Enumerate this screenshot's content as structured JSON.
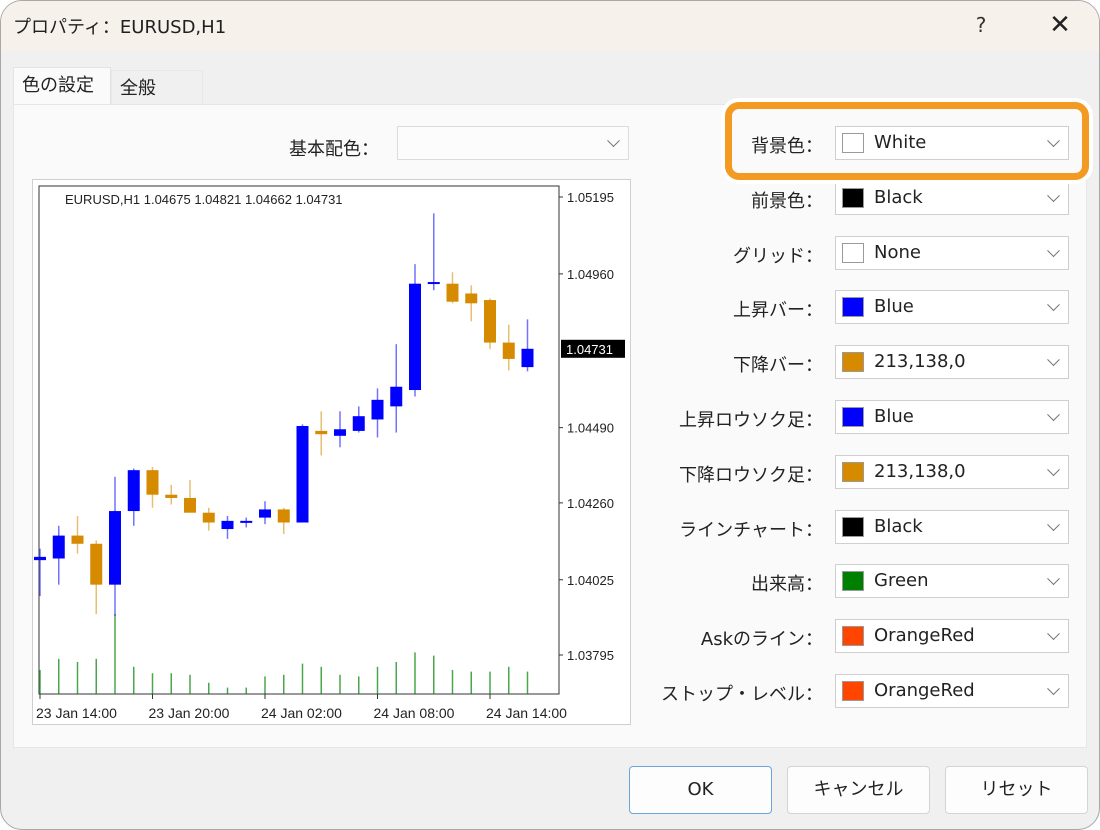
{
  "window": {
    "title": "プロパティ：EURUSD,H1",
    "help_label": "?",
    "close_label": "✕"
  },
  "tabs": [
    {
      "label": "色の設定",
      "active": true
    },
    {
      "label": "全般",
      "active": false
    }
  ],
  "base_scheme": {
    "label": "基本配色：",
    "value": ""
  },
  "color_settings": [
    {
      "label": "背景色：",
      "value": "White",
      "color": "#ffffff",
      "highlighted": true
    },
    {
      "label": "前景色：",
      "value": "Black",
      "color": "#000000"
    },
    {
      "label": "グリッド：",
      "value": "None",
      "color": "#ffffff"
    },
    {
      "label": "上昇バー：",
      "value": "Blue",
      "color": "#0000ff"
    },
    {
      "label": "下降バー：",
      "value": "213,138,0",
      "color": "#d58a00"
    },
    {
      "label": "上昇ロウソク足：",
      "value": "Blue",
      "color": "#0000ff"
    },
    {
      "label": "下降ロウソク足：",
      "value": "213,138,0",
      "color": "#d58a00"
    },
    {
      "label": "ラインチャート：",
      "value": "Black",
      "color": "#000000"
    },
    {
      "label": "出来高：",
      "value": "Green",
      "color": "#008000"
    },
    {
      "label": "Askのライン：",
      "value": "OrangeRed",
      "color": "#ff4500"
    },
    {
      "label": "ストップ・レベル：",
      "value": "OrangeRed",
      "color": "#ff4500"
    }
  ],
  "buttons": {
    "ok": "OK",
    "cancel": "キャンセル",
    "reset": "リセット"
  },
  "accent": {
    "highlight_color": "#f39a23"
  },
  "chart_data": {
    "type": "candlestick",
    "title": "EURUSD,H1  1.04675 1.04821 1.04662 1.04731",
    "symbol": "EURUSD,H1",
    "ohlc_header": [
      "1.04675",
      "1.04821",
      "1.04662",
      "1.04731"
    ],
    "current_price": "1.04731",
    "y_ticks": [
      "1.05195",
      "1.04960",
      "1.04731",
      "1.04490",
      "1.04260",
      "1.04025",
      "1.03795"
    ],
    "y_tick_values": [
      1.05195,
      1.0496,
      1.0449,
      1.0426,
      1.04025,
      1.03795
    ],
    "ylim": [
      1.0361,
      1.0524
    ],
    "x_ticks": [
      "23 Jan 14:00",
      "23 Jan 20:00",
      "24 Jan 02:00",
      "24 Jan 08:00",
      "24 Jan 14:00"
    ],
    "x_tick_index": [
      0,
      6,
      12,
      18,
      24
    ],
    "up_color": "#0000ff",
    "down_color": "#d58a00",
    "volume_color": "#008000",
    "candles": [
      {
        "o": 1.04085,
        "h": 1.0412,
        "l": 1.03975,
        "c": 1.04095
      },
      {
        "o": 1.0409,
        "h": 1.0419,
        "l": 1.0401,
        "c": 1.0416
      },
      {
        "o": 1.0416,
        "h": 1.0422,
        "l": 1.04105,
        "c": 1.04135
      },
      {
        "o": 1.04135,
        "h": 1.04145,
        "l": 1.0392,
        "c": 1.0401
      },
      {
        "o": 1.0401,
        "h": 1.0434,
        "l": 1.03915,
        "c": 1.04235
      },
      {
        "o": 1.04235,
        "h": 1.04365,
        "l": 1.0419,
        "c": 1.0436
      },
      {
        "o": 1.0436,
        "h": 1.0437,
        "l": 1.04245,
        "c": 1.04285
      },
      {
        "o": 1.04285,
        "h": 1.04315,
        "l": 1.04255,
        "c": 1.04275
      },
      {
        "o": 1.04275,
        "h": 1.0433,
        "l": 1.0423,
        "c": 1.0423
      },
      {
        "o": 1.0423,
        "h": 1.04245,
        "l": 1.04175,
        "c": 1.042
      },
      {
        "o": 1.0418,
        "h": 1.0422,
        "l": 1.0415,
        "c": 1.04205
      },
      {
        "o": 1.04205,
        "h": 1.04215,
        "l": 1.04185,
        "c": 1.04205
      },
      {
        "o": 1.04215,
        "h": 1.04265,
        "l": 1.04195,
        "c": 1.0424
      },
      {
        "o": 1.0424,
        "h": 1.04245,
        "l": 1.04165,
        "c": 1.042
      },
      {
        "o": 1.042,
        "h": 1.045,
        "l": 1.042,
        "c": 1.04495
      },
      {
        "o": 1.0448,
        "h": 1.0454,
        "l": 1.04405,
        "c": 1.0447
      },
      {
        "o": 1.04465,
        "h": 1.0454,
        "l": 1.0443,
        "c": 1.04485
      },
      {
        "o": 1.0448,
        "h": 1.04555,
        "l": 1.04475,
        "c": 1.04525
      },
      {
        "o": 1.04515,
        "h": 1.0461,
        "l": 1.0446,
        "c": 1.04575
      },
      {
        "o": 1.04555,
        "h": 1.04745,
        "l": 1.04475,
        "c": 1.04615
      },
      {
        "o": 1.04605,
        "h": 1.0499,
        "l": 1.04585,
        "c": 1.0493
      },
      {
        "o": 1.0493,
        "h": 1.05145,
        "l": 1.0491,
        "c": 1.04935
      },
      {
        "o": 1.0493,
        "h": 1.04965,
        "l": 1.0487,
        "c": 1.04875
      },
      {
        "o": 1.049,
        "h": 1.04925,
        "l": 1.04815,
        "c": 1.0487
      },
      {
        "o": 1.0488,
        "h": 1.04885,
        "l": 1.0473,
        "c": 1.0475
      },
      {
        "o": 1.0475,
        "h": 1.04805,
        "l": 1.04665,
        "c": 1.047
      },
      {
        "o": 1.04675,
        "h": 1.04821,
        "l": 1.04662,
        "c": 1.04731
      }
    ],
    "volumes": [
      0.3,
      0.44,
      0.4,
      0.44,
      1.0,
      0.34,
      0.26,
      0.26,
      0.24,
      0.14,
      0.08,
      0.08,
      0.22,
      0.24,
      0.38,
      0.34,
      0.24,
      0.22,
      0.34,
      0.4,
      0.52,
      0.48,
      0.3,
      0.28,
      0.28,
      0.34,
      0.28
    ]
  }
}
